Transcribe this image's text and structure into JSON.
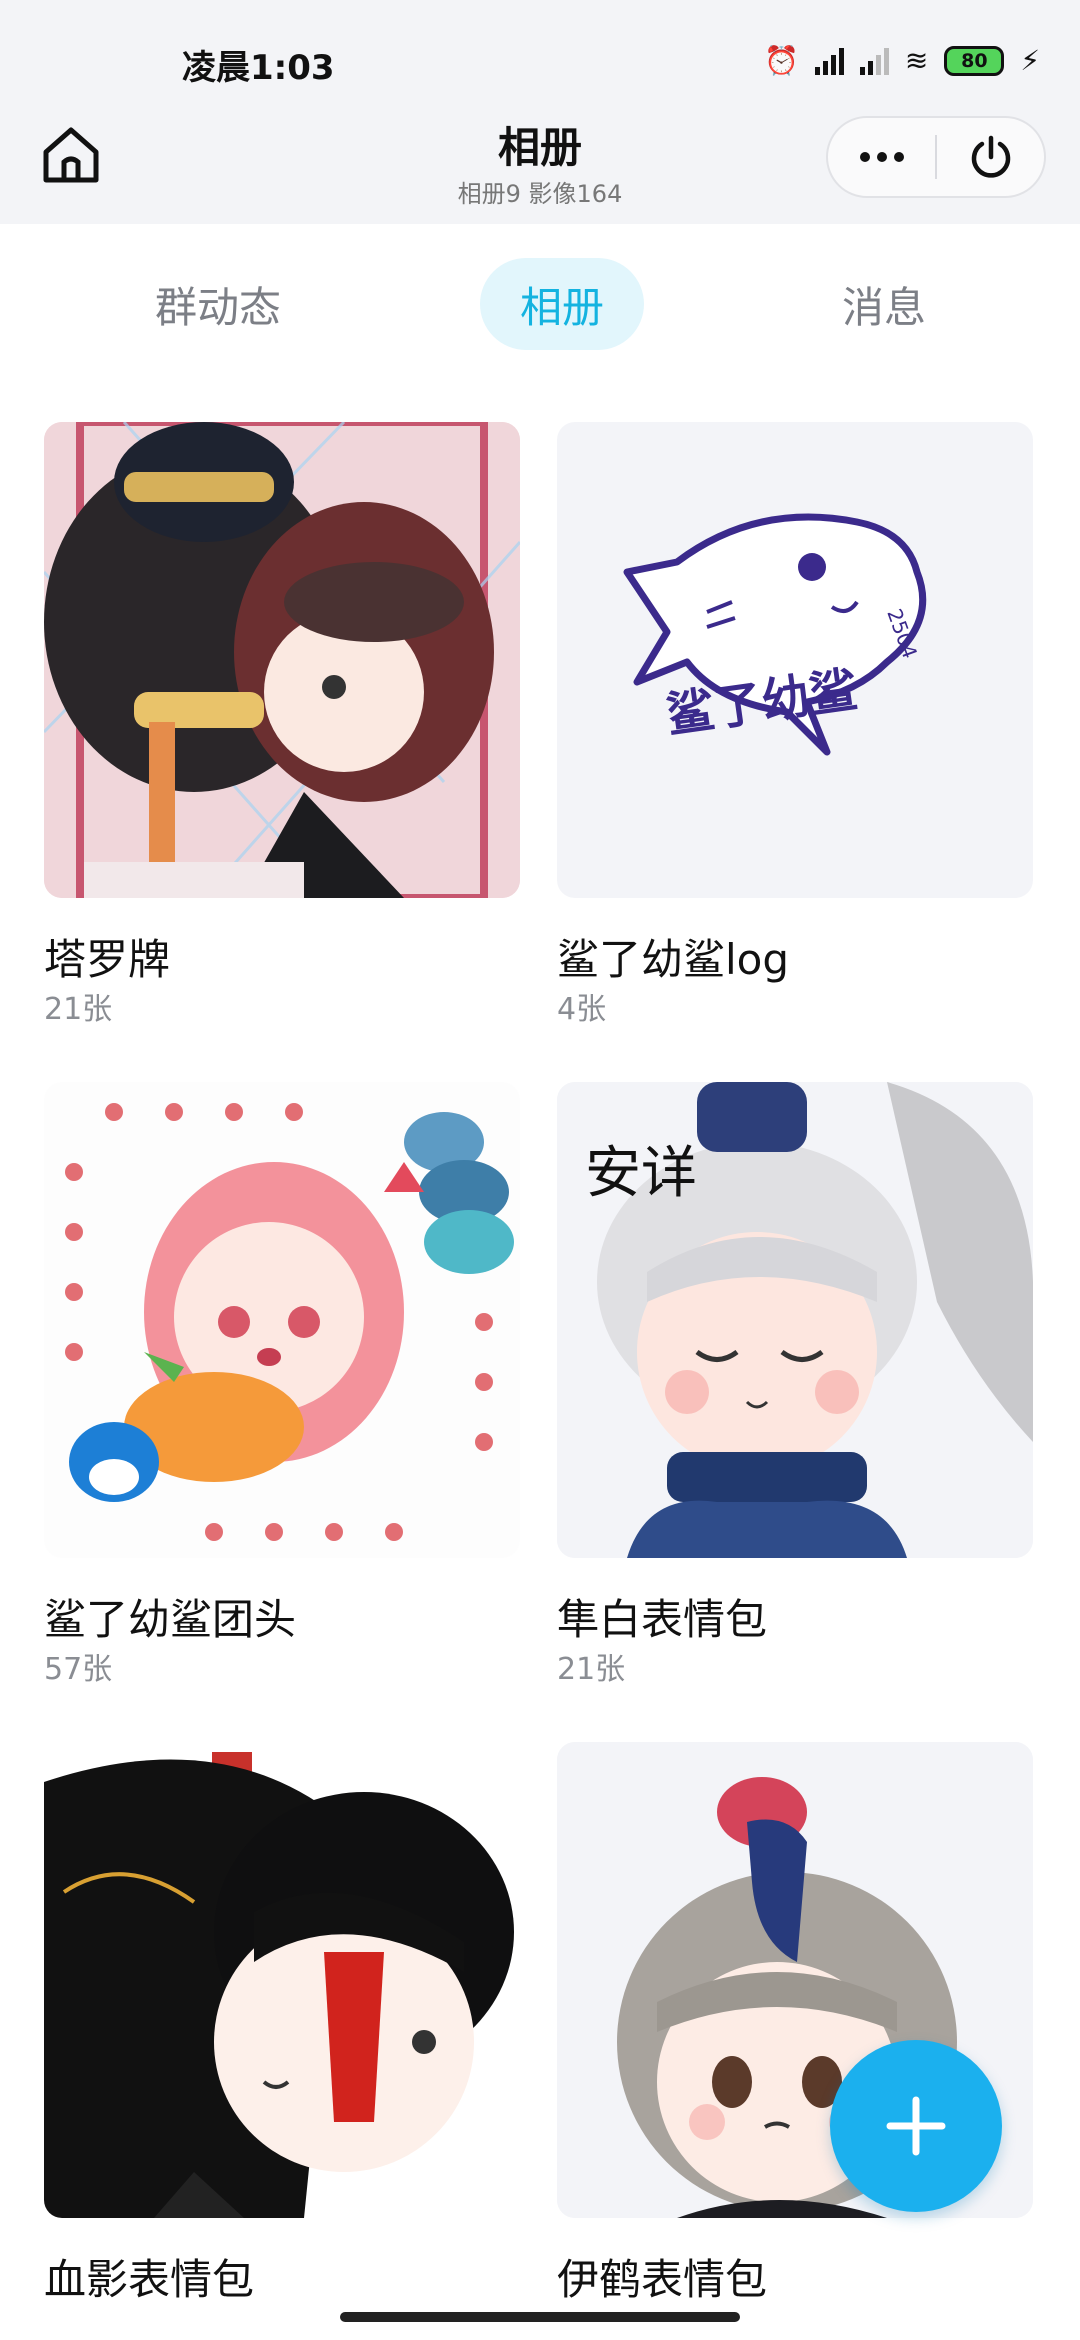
{
  "status_bar": {
    "time": "凌晨1:03",
    "battery": "80"
  },
  "header": {
    "title": "相册",
    "subtitle": "相册9 影像164"
  },
  "tabs": [
    {
      "label": "群动态",
      "active": false
    },
    {
      "label": "相册",
      "active": true
    },
    {
      "label": "消息",
      "active": false
    }
  ],
  "albums": [
    {
      "name": "塔罗牌",
      "count": "21张"
    },
    {
      "name": "鲨了幼鲨log",
      "count": "4张"
    },
    {
      "name": "鲨了幼鲨团头",
      "count": "57张"
    },
    {
      "name": "隼白表情包",
      "count": "21张"
    },
    {
      "name": "血影表情包",
      "count": ""
    },
    {
      "name": "伊鹤表情包",
      "count": ""
    }
  ],
  "thumb_art_text": {
    "shark_logo": "鲨了幼鲨",
    "shark_number": "2504",
    "sleep_text": "安详"
  },
  "colors": {
    "accent": "#14b3e0",
    "tab_active_bg": "#e2f6fc",
    "fab": "#1bb0ee",
    "header_bg": "#f3f4f7"
  }
}
